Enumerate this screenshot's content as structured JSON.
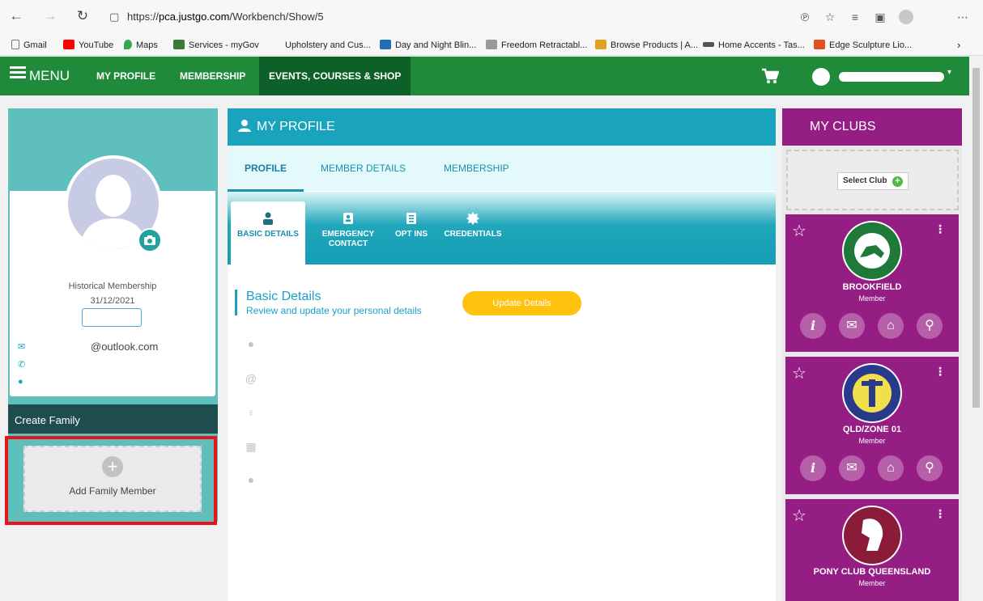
{
  "browser": {
    "url_prefix": "https://",
    "url_host": "pca.justgo.com",
    "url_path": "/Workbench/Show/5",
    "bookmarks": [
      {
        "label": "Gmail",
        "icon": "page-icon",
        "color": "#777777"
      },
      {
        "label": "YouTube",
        "icon": "youtube-icon",
        "color": "#ff0000"
      },
      {
        "label": "Maps",
        "icon": "maps-icon",
        "color": "#34a853"
      },
      {
        "label": "Services - myGov",
        "icon": "mygov-icon",
        "color": "#3a7a3a"
      },
      {
        "label": "Upholstery and Cus...",
        "icon": "",
        "color": ""
      },
      {
        "label": "Day and Night Blin...",
        "icon": "blinds-icon",
        "color": "#1e6fb5"
      },
      {
        "label": "Freedom Retractabl...",
        "icon": "freedom-icon",
        "color": "#777777"
      },
      {
        "label": "Browse Products | A...",
        "icon": "browse-icon",
        "color": "#e0a020"
      },
      {
        "label": "Home Accents - Tas...",
        "icon": "home-accents-icon",
        "color": "#555555"
      },
      {
        "label": "Edge Sculpture Lio...",
        "icon": "edge-icon",
        "color": "#e05020"
      }
    ]
  },
  "nav": {
    "menu_label": "MENU",
    "links": [
      "MY PROFILE",
      "MEMBERSHIP",
      "EVENTS, COURSES & SHOP"
    ],
    "active_link": "EVENTS, COURSES & SHOP"
  },
  "left_panel": {
    "historical_label": "Historical Membership",
    "historical_date": "31/12/2021",
    "email_suffix": "@outlook.com",
    "create_family_label": "Create Family",
    "add_family_label": "Add Family Member"
  },
  "center_panel": {
    "title": "MY PROFILE",
    "tabs": [
      "PROFILE",
      "MEMBER DETAILS",
      "MEMBERSHIP"
    ],
    "active_tab": "PROFILE",
    "sub_tabs": [
      {
        "label": "BASIC DETAILS",
        "icon": "person-icon"
      },
      {
        "label": "EMERGENCY CONTACT",
        "icon": "contact-card-icon"
      },
      {
        "label": "OPT INS",
        "icon": "checklist-icon"
      },
      {
        "label": "CREDENTIALS",
        "icon": "badge-icon"
      }
    ],
    "active_sub_tab": "BASIC DETAILS",
    "section_title": "Basic Details",
    "section_subtitle": "Review and update your personal details",
    "update_button": "Update Details"
  },
  "right_panel": {
    "title": "MY CLUBS",
    "select_club_label": "Select Club",
    "clubs": [
      {
        "name": "BROOKFIELD",
        "role": "Member",
        "logo_color": "#1f7a3a"
      },
      {
        "name": "QLD/ZONE 01",
        "role": "Member",
        "logo_color": "#2a3a8a"
      },
      {
        "name": "PONY CLUB QUEENSLAND",
        "role": "Member",
        "logo_color": "#8a1c3a"
      }
    ]
  },
  "colors": {
    "nav_green": "#1f8b3a",
    "teal": "#1aa3bd",
    "club_purple": "#951e84",
    "update_yellow": "#ffc20e",
    "highlight_red": "#e8141b"
  }
}
